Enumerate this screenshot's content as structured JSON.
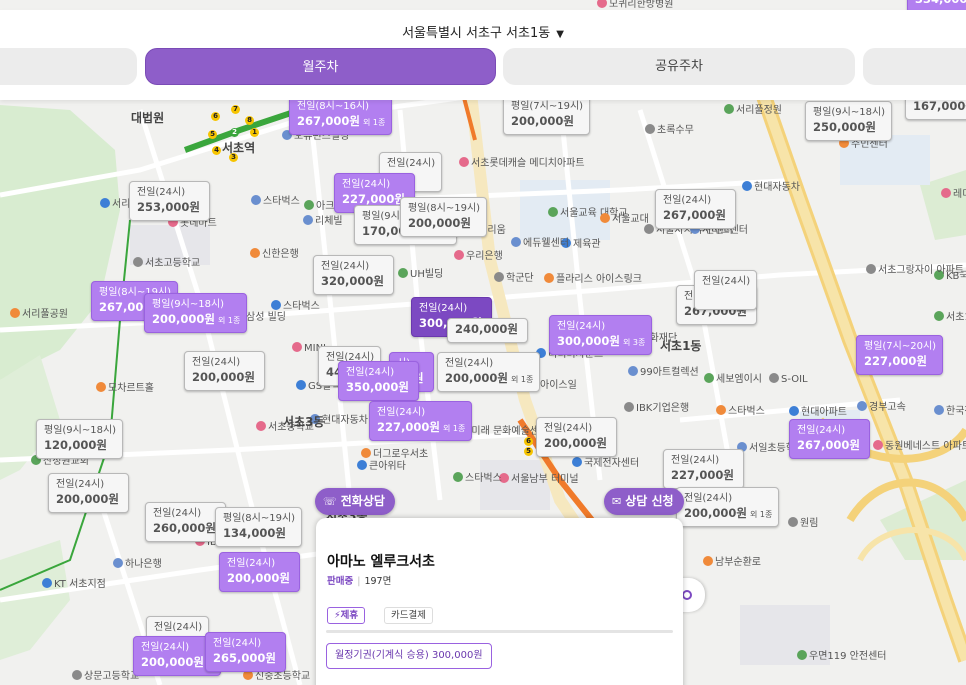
{
  "header": {
    "region": "서울특별시 서초구 서초1동",
    "caret": "▼",
    "tabs": [
      {
        "label": "",
        "active": false
      },
      {
        "label": "월주차",
        "active": true
      },
      {
        "label": "공유주차",
        "active": false
      },
      {
        "label": "",
        "active": false
      }
    ]
  },
  "actions": {
    "call_label": "전화상담",
    "consult_label": "상담 신청"
  },
  "card": {
    "title": "아마노 엘루크서초",
    "status": "판매중",
    "count": "197면",
    "tags": [
      "제휴",
      "카드결제"
    ],
    "ticket": "월정기권(기계식 승용) 300,000원"
  },
  "colors": {
    "accent": "#8e5ec9",
    "marker_purple": "#b27ff0",
    "marker_dark": "#7c49c2",
    "marker_gray": "#f6f6f6"
  },
  "markers": [
    {
      "style": "purple",
      "label": "전일(8시~16시)",
      "price": "267,000원",
      "extra": "외 1종"
    },
    {
      "style": "gray",
      "label": "평일(7시~19시)",
      "price": "200,000원",
      "extra": ""
    },
    {
      "style": "gray",
      "label": "평일(9시~18시)",
      "price": "250,000원",
      "extra": ""
    },
    {
      "style": "gray",
      "label": "",
      "price": "167,000원",
      "extra": ""
    },
    {
      "style": "gray",
      "label": "전일(24시)",
      "price": "253,000원",
      "extra": ""
    },
    {
      "style": "gray",
      "label": "전일(24시)",
      "price": "",
      "extra": "외 1종"
    },
    {
      "style": "purple",
      "label": "전일(24시)",
      "price": "227,000원",
      "extra": ""
    },
    {
      "style": "gray",
      "label": "평일(9시~18시)",
      "price": "170,000원",
      "extra": "외 1종"
    },
    {
      "style": "gray",
      "label": "평일(8시~19시)",
      "price": "200,000원",
      "extra": ""
    },
    {
      "style": "gray",
      "label": "전일(24시)",
      "price": "267,000원",
      "extra": ""
    },
    {
      "style": "gray",
      "label": "전일(24시)",
      "price": "320,000원",
      "extra": ""
    },
    {
      "style": "purple",
      "label": "평일(8시~19시)",
      "price": "267,000원",
      "extra": ""
    },
    {
      "style": "purple",
      "label": "평일(9시~18시)",
      "price": "200,000원",
      "extra": "외 1종"
    },
    {
      "style": "dark",
      "label": "전일(24시)",
      "price": "300,000원",
      "extra": ""
    },
    {
      "style": "gray",
      "label": "",
      "price": "240,000원",
      "extra": ""
    },
    {
      "style": "purple",
      "label": "전일(24시)",
      "price": "300,000원",
      "extra": "외 3종"
    },
    {
      "style": "gray",
      "label": "전일(24시)",
      "price": "267,000원",
      "extra": ""
    },
    {
      "style": "gray",
      "label": "전일(24시)",
      "price": "",
      "extra": ""
    },
    {
      "style": "gray",
      "label": "전일(24시)",
      "price": "200,000원",
      "extra": ""
    },
    {
      "style": "gray",
      "label": "전일(24시)",
      "price": "44",
      "extra": ""
    },
    {
      "style": "purple",
      "label": "시)",
      "price": "00원",
      "extra": ""
    },
    {
      "style": "gray",
      "label": "전일(24시)",
      "price": "200,000원",
      "extra": "외 1종"
    },
    {
      "style": "purple",
      "label": "전일(24시)",
      "price": "350,000원",
      "extra": ""
    },
    {
      "style": "purple",
      "label": "평일(7시~20시)",
      "price": "227,000원",
      "extra": ""
    },
    {
      "style": "gray",
      "label": "평일(9시~18시)",
      "price": "120,000원",
      "extra": ""
    },
    {
      "style": "purple",
      "label": "전일(24시)",
      "price": "227,000원",
      "extra": "외 1종"
    },
    {
      "style": "gray",
      "label": "전일(24시)",
      "price": "200,000원",
      "extra": ""
    },
    {
      "style": "purple",
      "label": "전일(24시)",
      "price": "267,000원",
      "extra": ""
    },
    {
      "style": "gray",
      "label": "전일(24시)",
      "price": "200,000원",
      "extra": ""
    },
    {
      "style": "gray",
      "label": "전일(24시)",
      "price": "227,000원",
      "extra": ""
    },
    {
      "style": "gray",
      "label": "전일(24시)",
      "price": "200,000원",
      "extra": "외 1종"
    },
    {
      "style": "gray",
      "label": "전일(24시)",
      "price": "260,000원",
      "extra": ""
    },
    {
      "style": "gray",
      "label": "평일(8시~19시)",
      "price": "134,000원",
      "extra": ""
    },
    {
      "style": "purple",
      "label": "전일(24시)",
      "price": "200,000원",
      "extra": ""
    },
    {
      "style": "gray",
      "label": "전일(24시)",
      "price": "",
      "extra": ""
    },
    {
      "style": "purple",
      "label": "전일(24시)",
      "price": "200,000원",
      "extra": "외"
    },
    {
      "style": "purple",
      "label": "전일(24시)",
      "price": "265,000원",
      "extra": ""
    },
    {
      "style": "purple",
      "label": "",
      "price": "334,000원",
      "extra": ""
    }
  ],
  "pois": [
    "대법원",
    "서초역",
    "오퓨런스빌딩",
    "모퀴리한방병원",
    "서리풀정원",
    "초록수무",
    "주민센터",
    "서리풀",
    "스타벅스",
    "롯데마트",
    "아크로비스타",
    "서초고등학교",
    "신한은행",
    "아이리움",
    "리체빌",
    "서초롯데캐슬 메디치아파트",
    "서울교육 대학교",
    "서울자치 주민센터",
    "서울교대",
    "제육관",
    "에듀웰센터",
    "우리은행",
    "UH빌딩",
    "학군단",
    "플라리스 아이스링크",
    "현대자동차",
    "서비스센터",
    "레미안",
    "KB국민은행",
    "서초그랑자이 아파트",
    "서리풀공원",
    "스타벅스",
    "삼성 빌딩",
    "MINI",
    "서초119 안전센터",
    "정효문화재단",
    "서초1동",
    "리티버사운드",
    "99아트컬렉션",
    "아이스일",
    "세보엠이시",
    "S-OIL",
    "모차르트홀",
    "GS칼텍스",
    "현대자동차",
    "서초중학교",
    "서초3동",
    "IBK기업은행",
    "스타벅스",
    "현대아파트",
    "한국전자 강남전",
    "동원베네스트 아파트",
    "산정원교회",
    "한국미래 문화예술센터",
    "더그로우서초",
    "국제전자센터",
    "서일초등학교",
    "서울남부 터미널",
    "스타벅스",
    "원림",
    "남부순환로",
    "KT 서초지점",
    "하나은행",
    "IBK",
    "우면119 안전센터",
    "상문고등학교",
    "신중초등학교",
    "큰아위타",
    "경부고속",
    "서초3동"
  ]
}
